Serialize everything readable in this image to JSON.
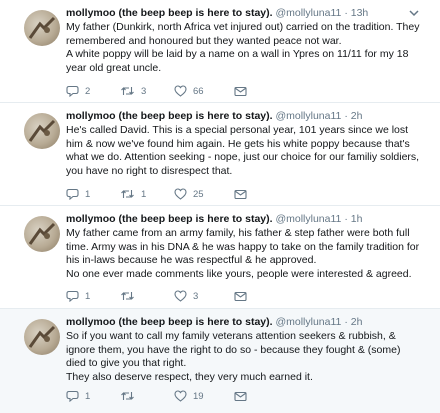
{
  "tweets": [
    {
      "name": "mollymoo (the beep beep is here to stay).",
      "handle": "@mollyluna11",
      "time": "13h",
      "lines": [
        "My father (Dunkirk, north Africa vet injured out) carried on the tradition. They remembered and honoured but they wanted peace not war.",
        "A white poppy will be laid by a name on a wall in Ypres on 11/11 for my 18 year old great uncle."
      ],
      "replies": "2",
      "retweets": "3",
      "likes": "66"
    },
    {
      "name": "mollymoo (the beep beep is here to stay).",
      "handle": "@mollyluna11",
      "time": "2h",
      "lines": [
        "He's called David. This is a special personal year, 101 years since we lost him & now we've found him again. He gets his white poppy because that's what we do. Attention seeking - nope, just our choice for our familiy soldiers, you have no right to disrespect that."
      ],
      "replies": "1",
      "retweets": "1",
      "likes": "25"
    },
    {
      "name": "mollymoo (the beep beep is here to stay).",
      "handle": "@mollyluna11",
      "time": "1h",
      "lines": [
        "My father came from an army family, his father & step father were both full time. Army was in his DNA & he was happy to take on the family tradition for his in-laws because he was respectful & he approved.",
        "No one ever made comments like yours, people were interested & agreed."
      ],
      "replies": "1",
      "retweets": "",
      "likes": "3"
    },
    {
      "name": "mollymoo (the beep beep is here to stay).",
      "handle": "@mollyluna11",
      "time": "2h",
      "lines": [
        "So if you want to call my family veterans attention seekers & rubbish, & ignore them, you have the right to do so - because they fought & (some) died to give you that right.",
        "They also deserve respect, they very much earned it."
      ],
      "replies": "1",
      "retweets": "",
      "likes": "19"
    }
  ],
  "colors": {
    "text": "#14171a",
    "muted": "#657786",
    "icon": "#657786",
    "highlight": "#f5f8fa",
    "divider": "#e6ecf0"
  }
}
